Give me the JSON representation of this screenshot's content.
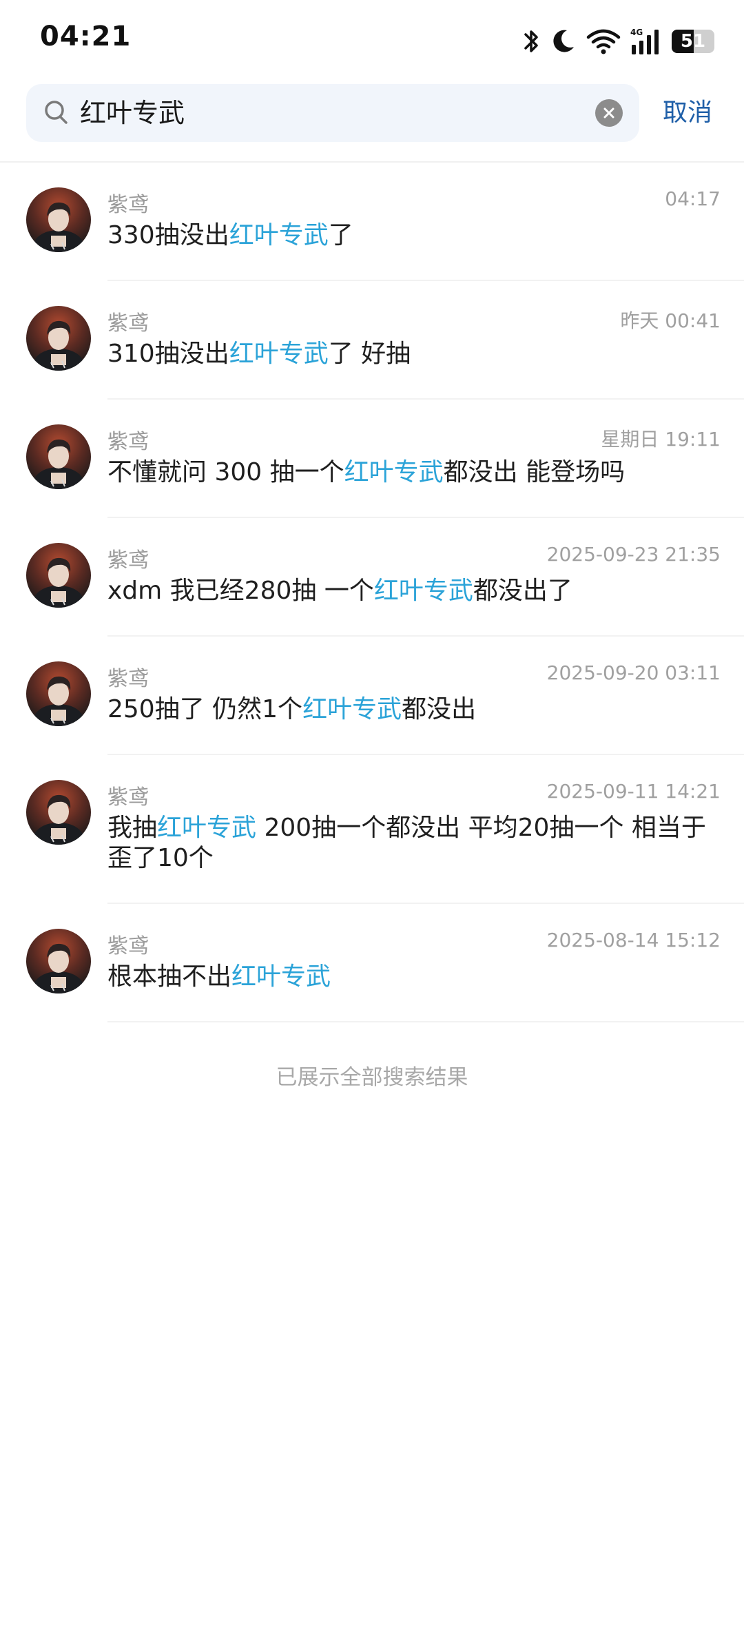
{
  "status_bar": {
    "time": "04:21",
    "battery_level": "51",
    "icons": [
      "bluetooth-icon",
      "moon-icon",
      "wifi-icon",
      "signal-4g-icon",
      "battery-icon"
    ]
  },
  "search": {
    "query": "红叶专武",
    "cancel_label": "取消",
    "icon": "search-icon",
    "clear_icon": "clear-icon"
  },
  "colors": {
    "highlight": "#2ba3d8",
    "cancel": "#1f5fa8",
    "search_bg": "#f1f5fb"
  },
  "results": [
    {
      "sender": "紫鸢",
      "time": "04:17",
      "parts": [
        "330抽没出",
        "红叶专武",
        "了"
      ]
    },
    {
      "sender": "紫鸢",
      "time": "昨天 00:41",
      "parts": [
        "310抽没出",
        "红叶专武",
        "了  好抽"
      ]
    },
    {
      "sender": "紫鸢",
      "time": "星期日 19:11",
      "parts": [
        "不懂就问  300 抽一个",
        "红叶专武",
        "都没出 能登场吗"
      ]
    },
    {
      "sender": "紫鸢",
      "time": "2025-09-23 21:35",
      "parts": [
        "xdm  我已经280抽 一个",
        "红叶专武",
        "都没出了"
      ]
    },
    {
      "sender": "紫鸢",
      "time": "2025-09-20 03:11",
      "parts": [
        "250抽了 仍然1个",
        "红叶专武",
        "都没出"
      ]
    },
    {
      "sender": "紫鸢",
      "time": "2025-09-11 14:21",
      "parts": [
        "我抽",
        "红叶专武",
        " 200抽一个都没出 平均20抽一个 相当于歪了10个"
      ]
    },
    {
      "sender": "紫鸢",
      "time": "2025-08-14 15:12",
      "parts": [
        "根本抽不出",
        "红叶专武",
        ""
      ]
    }
  ],
  "end_text": "已展示全部搜索结果"
}
